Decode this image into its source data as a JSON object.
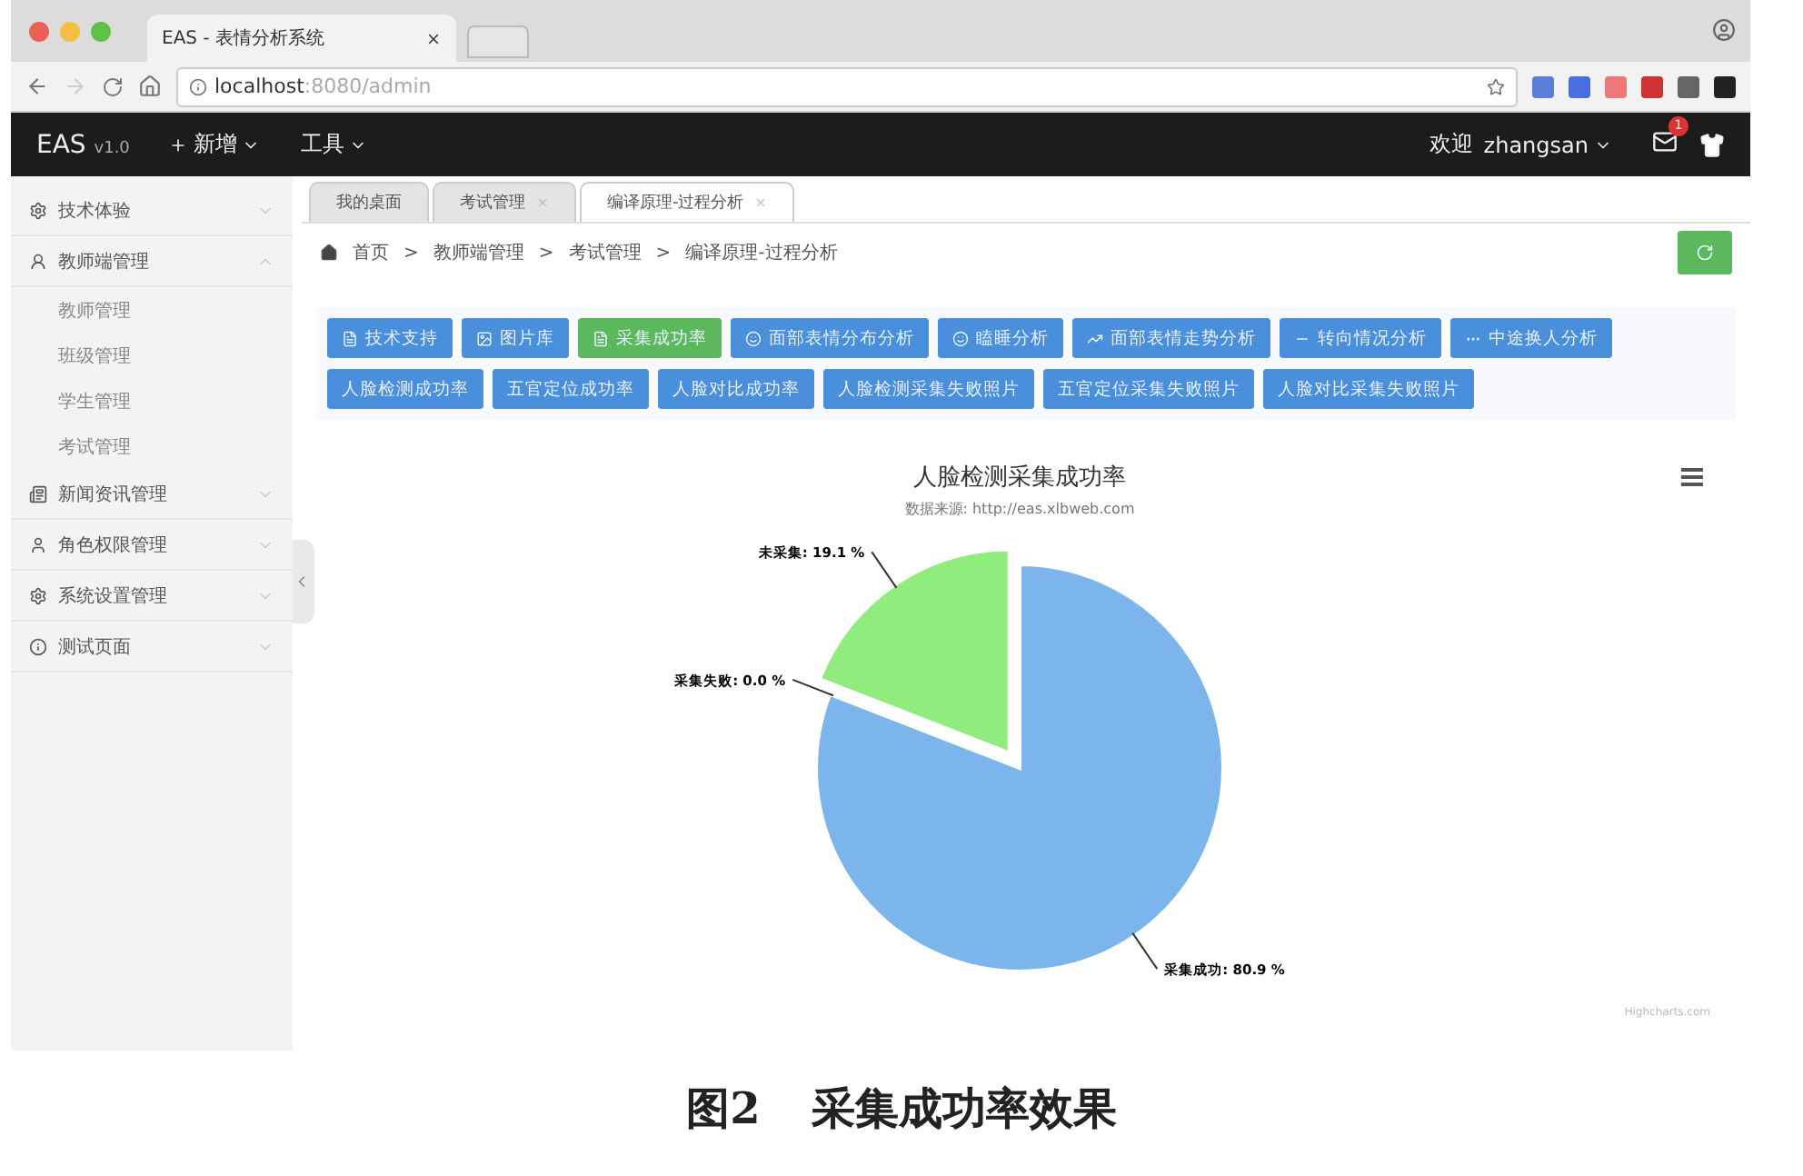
{
  "browser": {
    "tab_title": "EAS - 表情分析系统",
    "url_host": "localhost",
    "url_path": ":8080/admin"
  },
  "header": {
    "brand": "EAS",
    "version": "v1.0",
    "menus": [
      "新增",
      "工具"
    ],
    "welcome": "欢迎",
    "user": "zhangsan",
    "badge": "1"
  },
  "sidebar": {
    "items": [
      {
        "label": "技术体验",
        "expanded": false
      },
      {
        "label": "教师端管理",
        "expanded": true,
        "children": [
          {
            "label": "教师管理"
          },
          {
            "label": "班级管理"
          },
          {
            "label": "学生管理"
          },
          {
            "label": "考试管理"
          }
        ]
      },
      {
        "label": "新闻资讯管理",
        "expanded": false
      },
      {
        "label": "角色权限管理",
        "expanded": false
      },
      {
        "label": "系统设置管理",
        "expanded": false
      },
      {
        "label": "测试页面",
        "expanded": false
      }
    ]
  },
  "tabs": [
    {
      "label": "我的桌面",
      "closable": false,
      "selected": false
    },
    {
      "label": "考试管理",
      "closable": true,
      "selected": false
    },
    {
      "label": "编译原理-过程分析",
      "closable": true,
      "selected": true
    }
  ],
  "breadcrumb": {
    "separator": ">",
    "items": [
      "首页",
      "教师端管理",
      "考试管理",
      "编译原理-过程分析"
    ]
  },
  "buttons": [
    {
      "label": "技术支持",
      "selected": false
    },
    {
      "label": "图片库",
      "selected": false
    },
    {
      "label": "采集成功率",
      "selected": true
    },
    {
      "label": "面部表情分布分析",
      "selected": false
    },
    {
      "label": "瞌睡分析",
      "selected": false
    },
    {
      "label": "面部表情走势分析",
      "selected": false
    },
    {
      "label": "转向情况分析",
      "selected": false
    },
    {
      "label": "中途换人分析",
      "selected": false
    }
  ],
  "buttons_row2": [
    {
      "label": "人脸检测成功率"
    },
    {
      "label": "五官定位成功率"
    },
    {
      "label": "人脸对比成功率"
    },
    {
      "label": "人脸检测采集失败照片"
    },
    {
      "label": "五官定位采集失败照片"
    },
    {
      "label": "人脸对比采集失败照片"
    }
  ],
  "chart": {
    "credits": "Highcharts.com",
    "sliced": [
      false,
      false,
      true
    ],
    "chart_data": {
      "type": "pie",
      "title": "人脸检测采集成功率",
      "subtitle": "数据来源: http://eas.xlbweb.com",
      "values": [
        80.9,
        0.0,
        19.1
      ],
      "colors": [
        "#7cb5ec",
        "#434348",
        "#90ed7d"
      ],
      "value_labels": [
        "采集成功: 80.9 %",
        "采集失败: 0.0 %",
        "未采集: 19.1 %"
      ]
    }
  },
  "caption": {
    "number": "图2",
    "text": "采集成功率效果"
  }
}
